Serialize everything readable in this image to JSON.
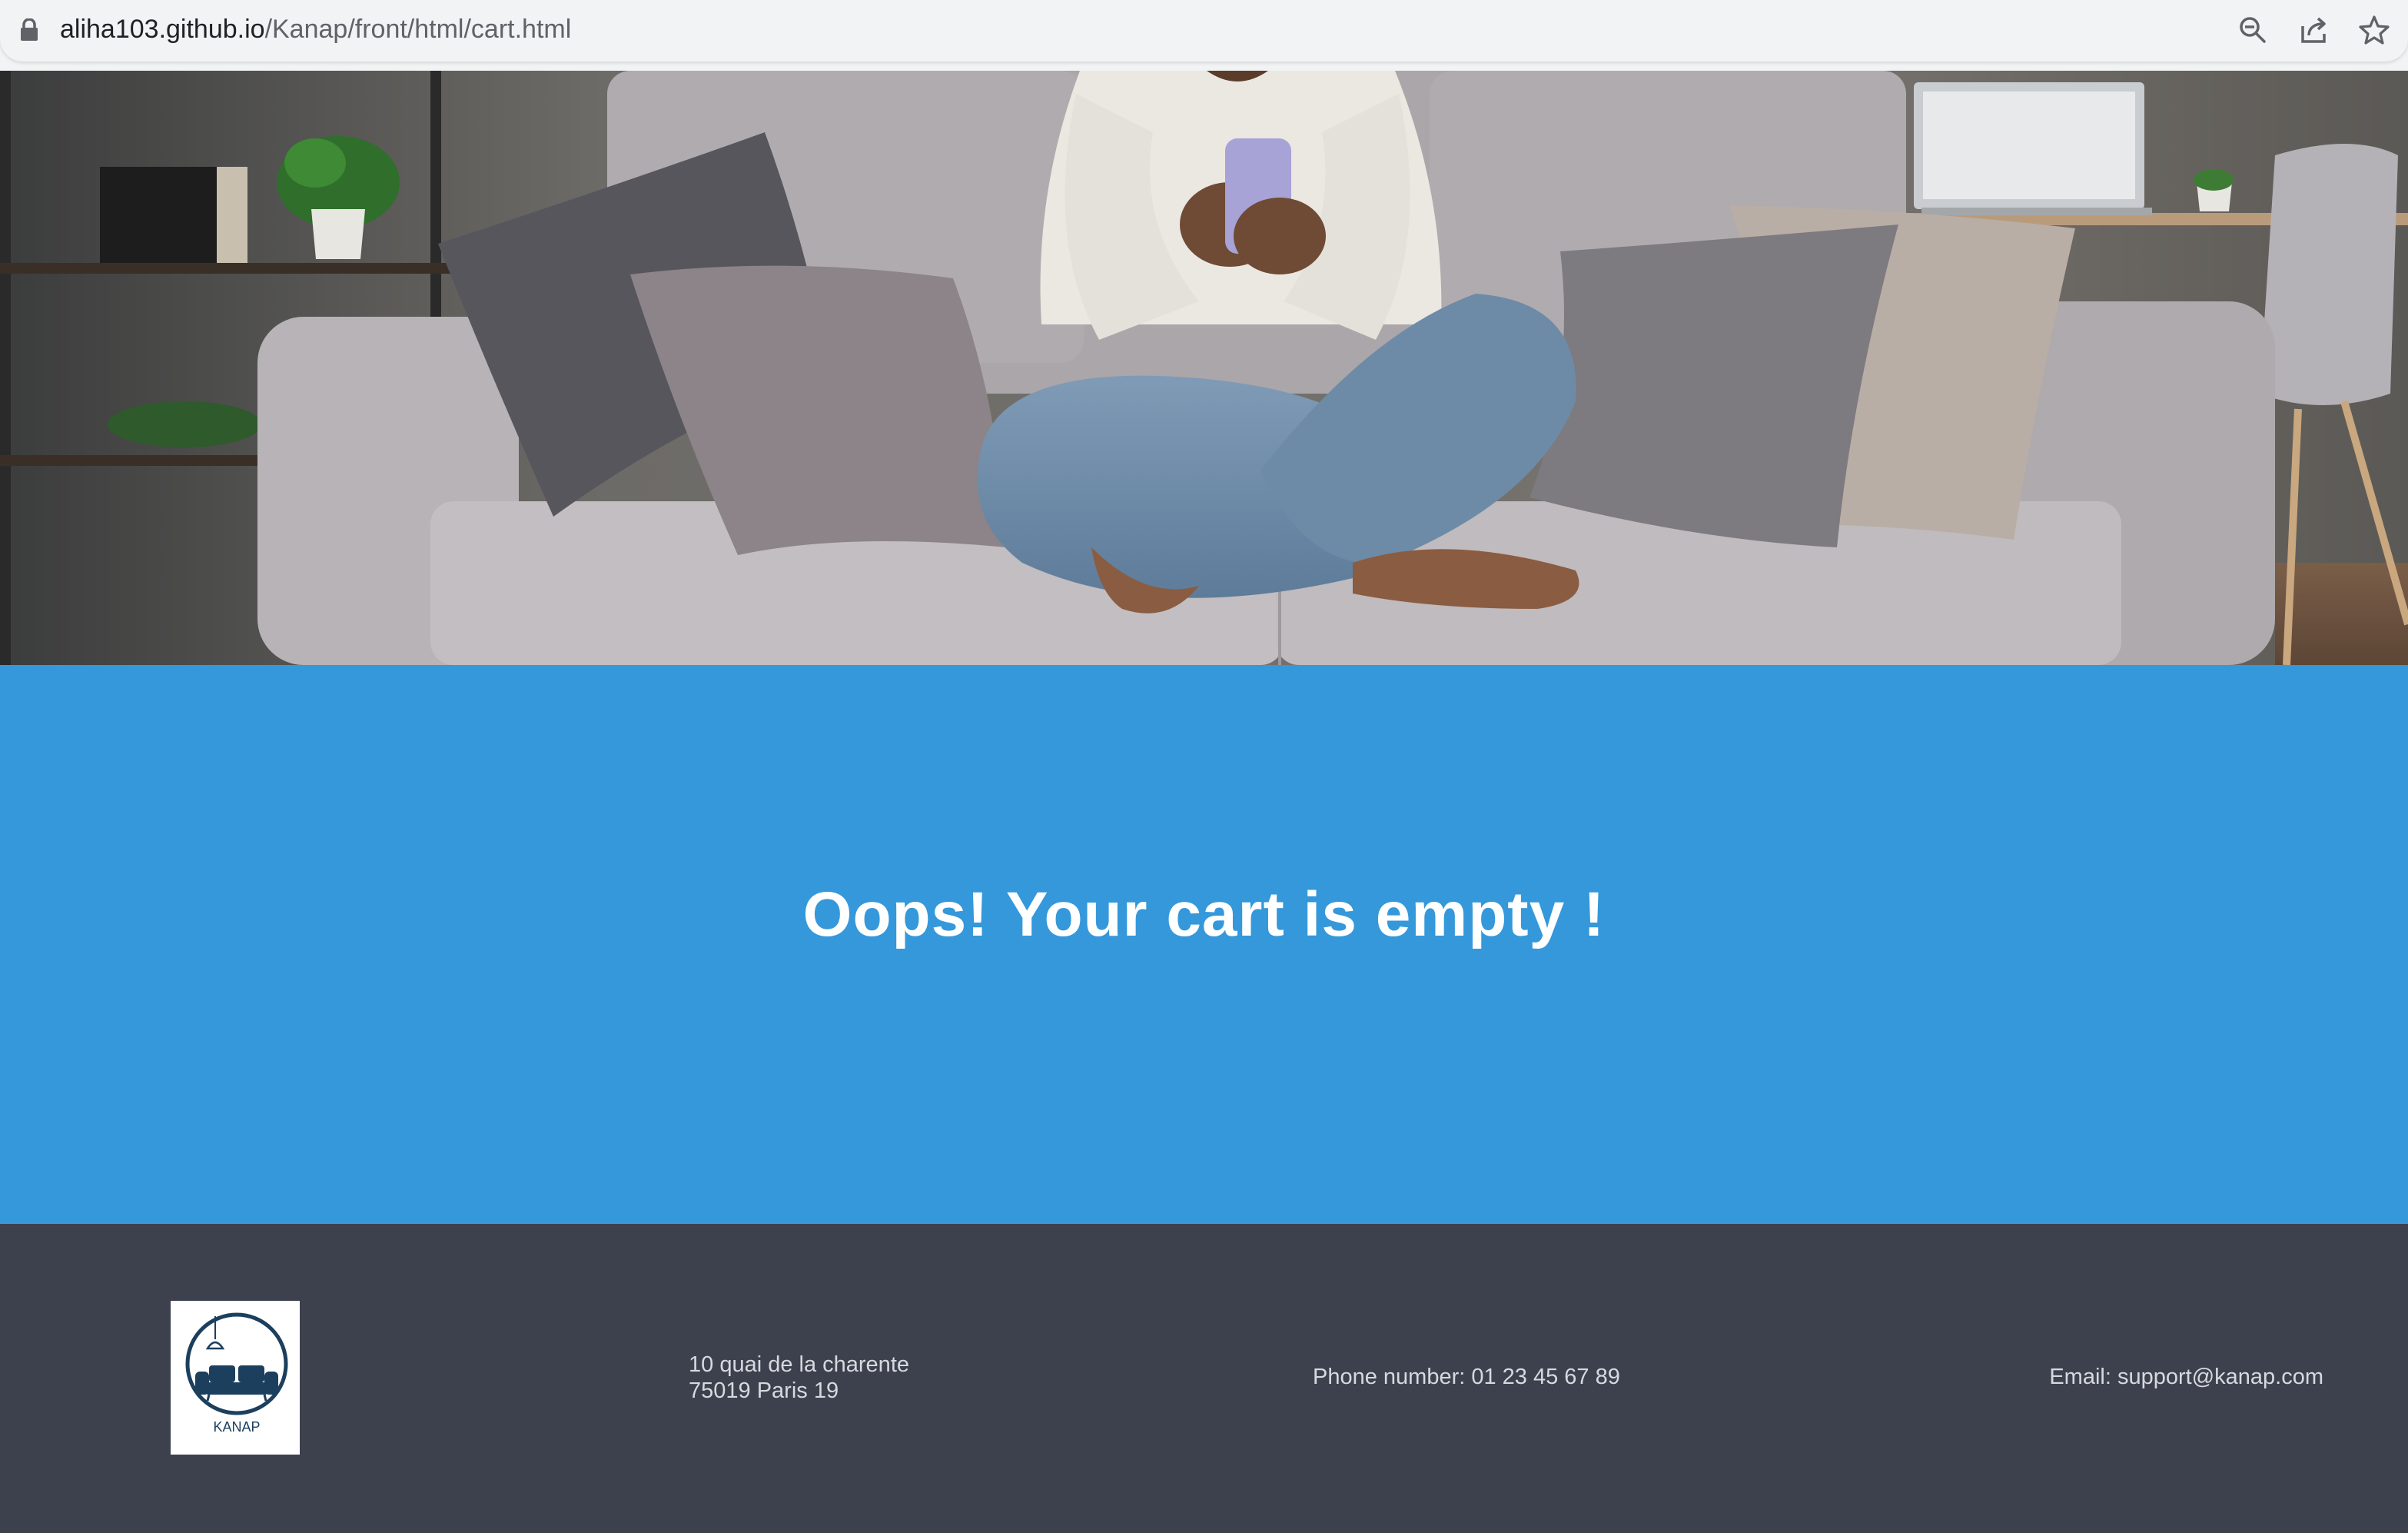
{
  "browser": {
    "url_host": "aliha103.github.io",
    "url_path": "/Kanap/front/html/cart.html",
    "icons": [
      "lock-icon",
      "zoom-out-icon",
      "share-icon",
      "bookmark-star-icon"
    ]
  },
  "hero": {
    "image": "woman-sitting-on-sofa-with-phone"
  },
  "cart": {
    "empty_message": "Oops! Your cart is empty !"
  },
  "footer": {
    "logo_text": "KANAP",
    "address_line1": "10 quai de la charente",
    "address_line2": "75019 Paris 19",
    "phone": "Phone number: 01 23 45 67 89",
    "email": "Email: support@kanap.com"
  },
  "colors": {
    "browser_bar": "#f1f3f4",
    "cart_section": "#3498db",
    "footer": "#3d414e",
    "footer_text": "#d7d9df",
    "logo_navy": "#1c3f5e"
  }
}
